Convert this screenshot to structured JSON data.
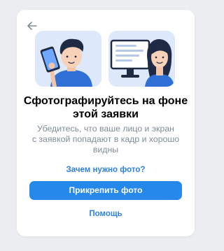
{
  "dialog": {
    "back_icon": "arrow-left-icon",
    "title": "Сфотографируйтесь на фоне\nэтой заявки",
    "description": "Убедитесь, что ваше лицо и экран\nс заявкой попадают в кадр и хорошо\nвидны",
    "why_link": "Зачем нужно фото?",
    "attach_button": "Прикрепить фото",
    "help_link": "Помощь"
  },
  "colors": {
    "accent": "#2688eb",
    "link": "#2d81e0",
    "illustration_bg": "#dde9fb",
    "page_bg": "#ebedf0"
  }
}
